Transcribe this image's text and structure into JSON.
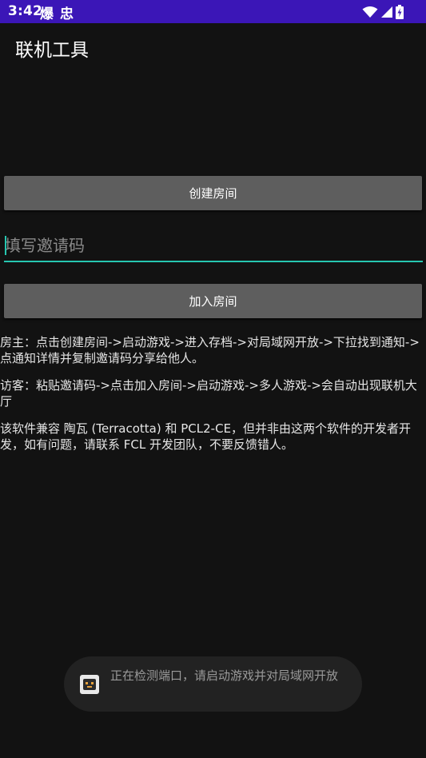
{
  "status_bar": {
    "time": "3:42",
    "notification_glyphs": [
      "爆",
      "忠"
    ],
    "color": "#3b16b7"
  },
  "app": {
    "title": "联机工具"
  },
  "buttons": {
    "create_room": "创建房间",
    "join_room": "加入房间"
  },
  "invite_input": {
    "placeholder": "填写邀请码",
    "value": "",
    "accent_color": "#26c6b0"
  },
  "instructions": {
    "host": "房主：点击创建房间->启动游戏->进入存档->对局域网开放->下拉找到通知->点通知详情并复制邀请码分享给他人。",
    "guest": "访客：粘贴邀请码->点击加入房间->启动游戏->多人游戏->会自动出现联机大厅",
    "note": "该软件兼容 陶瓦 (Terracotta) 和 PCL2-CE，但并非由这两个软件的开发者开发，如有问题，请联系 FCL 开发团队，不要反馈错人。"
  },
  "toast": {
    "message": "正在检测端口，请启动游戏并对局域网开放"
  }
}
